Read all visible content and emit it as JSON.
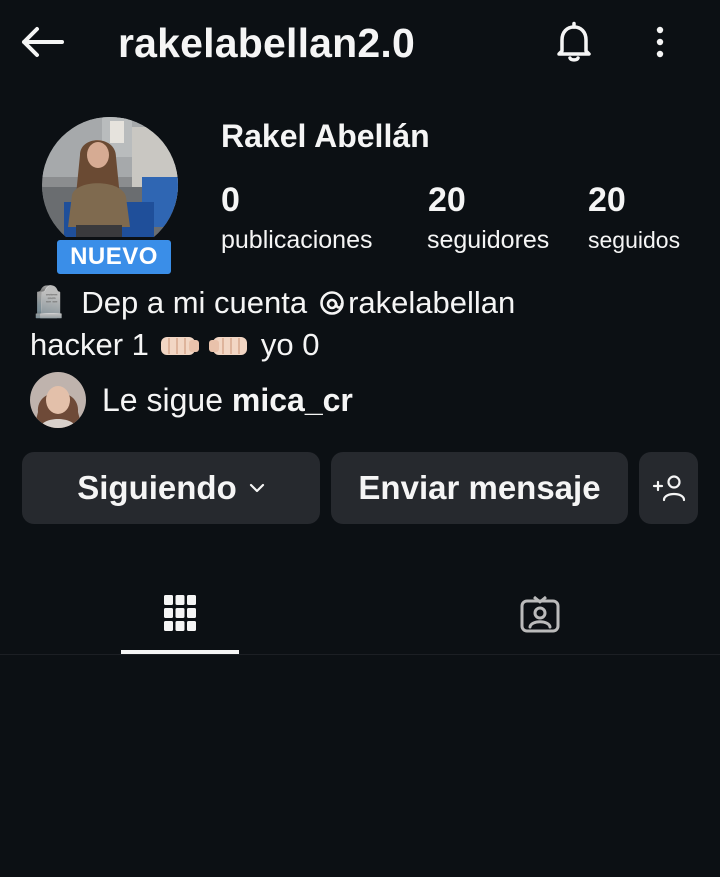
{
  "header": {
    "username": "rakelabellan2.0",
    "back_icon": "arrow-left-icon",
    "bell_icon": "bell-icon",
    "more_icon": "more-vertical-icon"
  },
  "profile": {
    "full_name": "Rakel Abellán",
    "badge": "NUEVO",
    "stats": [
      {
        "value": "0",
        "label": "publicaciones"
      },
      {
        "value": "20",
        "label": "seguidores"
      },
      {
        "value": "20",
        "label": "seguidos"
      }
    ],
    "bio": {
      "line1_emoji": "🪦",
      "line1_text": "Dep a mi cuenta",
      "threads_icon": "threads-icon",
      "line1_handle": "rakelabellan",
      "line2_start": "hacker 1",
      "line2_emoji": "fist-bump-emoji",
      "line2_end": "yo 0"
    },
    "followed_by": {
      "prefix": "Le sigue",
      "username": "mica_cr"
    }
  },
  "actions": {
    "following_label": "Siguiendo",
    "message_label": "Enviar mensaje",
    "add_user_icon": "add-user-icon"
  },
  "tabs": [
    {
      "icon": "grid-icon",
      "selected": true
    },
    {
      "icon": "tagged-person-icon",
      "selected": false
    }
  ],
  "colors": {
    "background": "#0c1014",
    "button": "#26292e",
    "badge": "#3a8ee8",
    "text": "#f5f5f5"
  }
}
